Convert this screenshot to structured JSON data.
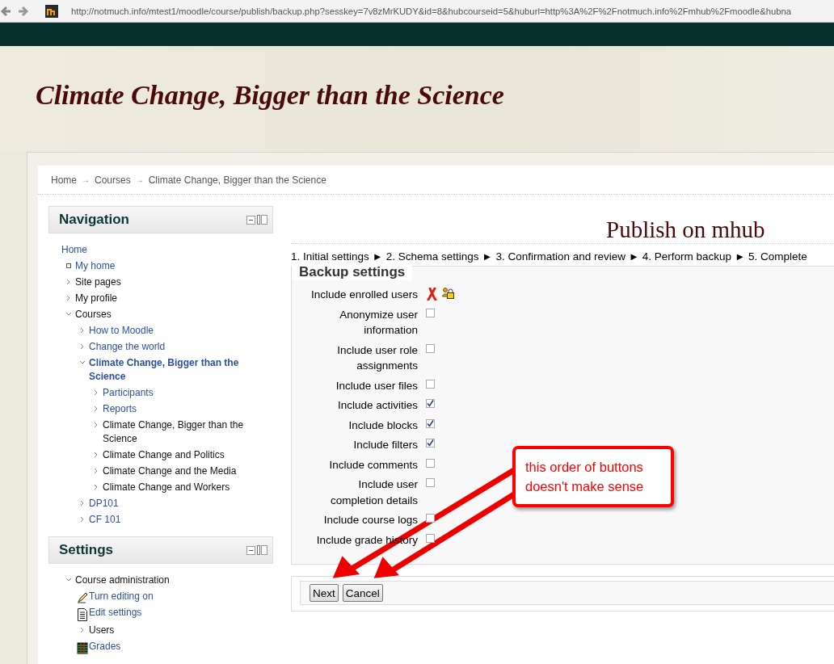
{
  "browser": {
    "url": "http://notmuch.info/mtest1/moodle/course/publish/backup.php?sesskey=7v8zMrKUDY&id=8&hubcourseid=5&huburl=http%3A%2F%2Fnotmuch.info%2Fmhub%2Fmoodle&hubna"
  },
  "site_title": "Climate Change, Bigger than the Science",
  "breadcrumb": [
    "Home",
    "→",
    "Courses",
    "→",
    "Climate Change, Bigger than the Science"
  ],
  "navigation": {
    "title": "Navigation",
    "items": [
      {
        "label": "Home",
        "kind": "plain",
        "link": true
      },
      {
        "label": "My home",
        "kind": "bullet",
        "link": true
      },
      {
        "label": "Site pages",
        "kind": "branch",
        "link": false,
        "expanded": false
      },
      {
        "label": "My profile",
        "kind": "branch",
        "link": false,
        "expanded": false
      },
      {
        "label": "Courses",
        "kind": "branch",
        "link": false,
        "expanded": true,
        "children": [
          {
            "label": "How to Moodle",
            "kind": "branch",
            "link": true,
            "expanded": false,
            "current": false
          },
          {
            "label": "Change the world",
            "kind": "branch",
            "link": true,
            "expanded": false,
            "current": false
          },
          {
            "label": "Climate Change, Bigger than the Science",
            "kind": "branch",
            "link": true,
            "expanded": true,
            "current": true,
            "children": [
              {
                "label": "Participants",
                "kind": "branch",
                "link": true,
                "expanded": false
              },
              {
                "label": "Reports",
                "kind": "branch",
                "link": true,
                "expanded": false
              },
              {
                "label": "Climate Change, Bigger than the Science",
                "kind": "branch",
                "link": false,
                "expanded": false
              },
              {
                "label": "Climate Change and Politics",
                "kind": "branch",
                "link": false,
                "expanded": false
              },
              {
                "label": "Climate Change and the Media",
                "kind": "branch",
                "link": false,
                "expanded": false
              },
              {
                "label": "Climate Change and Workers",
                "kind": "branch",
                "link": false,
                "expanded": false
              }
            ]
          },
          {
            "label": "DP101",
            "kind": "branch",
            "link": true,
            "expanded": false,
            "current": false
          },
          {
            "label": "CF 101",
            "kind": "branch",
            "link": true,
            "expanded": false,
            "current": false
          }
        ]
      }
    ]
  },
  "settings": {
    "title": "Settings",
    "items": [
      {
        "label": "Course administration",
        "kind": "branch",
        "link": false,
        "expanded": true,
        "children": [
          {
            "label": "Turn editing on",
            "kind": "pencil",
            "link": true
          },
          {
            "label": "Edit settings",
            "kind": "document",
            "link": true
          },
          {
            "label": "Users",
            "kind": "branch",
            "link": false,
            "expanded": false
          },
          {
            "label": "Grades",
            "kind": "table",
            "link": true
          }
        ]
      }
    ]
  },
  "page_heading": "Publish on mhub",
  "steps": [
    "1. Initial settings",
    "►",
    "2. Schema settings",
    "►",
    "3. Confirmation and review",
    "►",
    "4. Perform backup",
    "►",
    "5. Complete"
  ],
  "backup_settings": {
    "legend": "Backup settings",
    "rows": [
      {
        "label": "Include enrolled users",
        "kind": "locked"
      },
      {
        "label": "Anonymize user information",
        "kind": "checkbox",
        "checked": false
      },
      {
        "label": "Include user role assignments",
        "kind": "checkbox",
        "checked": false
      },
      {
        "label": "Include user files",
        "kind": "checkbox",
        "checked": false
      },
      {
        "label": "Include activities",
        "kind": "checkbox",
        "checked": true
      },
      {
        "label": "Include blocks",
        "kind": "checkbox",
        "checked": true
      },
      {
        "label": "Include filters",
        "kind": "checkbox",
        "checked": true
      },
      {
        "label": "Include comments",
        "kind": "checkbox",
        "checked": false
      },
      {
        "label": "Include user completion details",
        "kind": "checkbox",
        "checked": false
      },
      {
        "label": "Include course logs",
        "kind": "checkbox",
        "checked": false
      },
      {
        "label": "Include grade history",
        "kind": "checkbox",
        "checked": false
      }
    ]
  },
  "buttons": [
    "Next",
    "Cancel"
  ],
  "annotation": {
    "text": "this order of buttons doesn't make sense"
  }
}
